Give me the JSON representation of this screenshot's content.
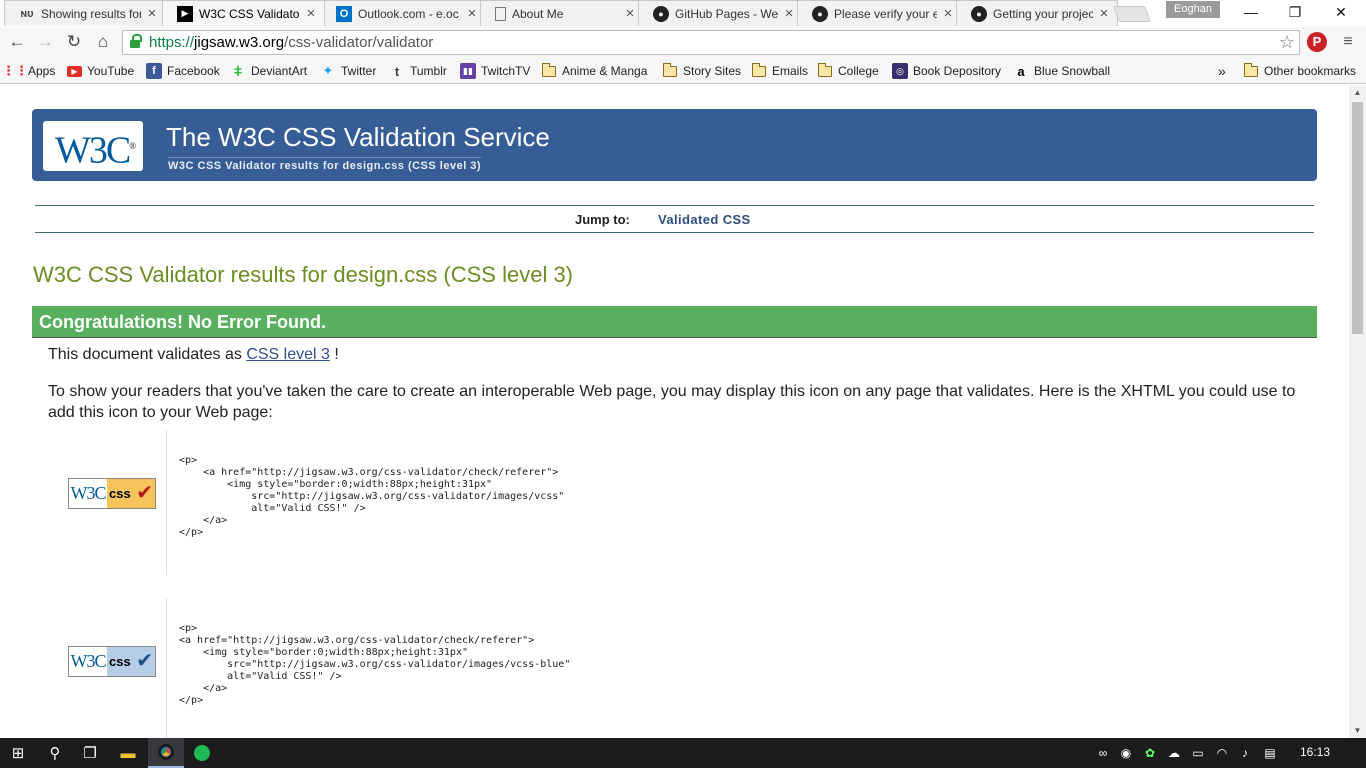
{
  "browser": {
    "tabs": [
      {
        "title": "Showing results for",
        "icon": "nu"
      },
      {
        "title": "W3C CSS Validator",
        "icon": "w3c"
      },
      {
        "title": "Outlook.com - e.oc",
        "icon": "outlook"
      },
      {
        "title": "About Me",
        "icon": "page"
      },
      {
        "title": "GitHub Pages - We",
        "icon": "github"
      },
      {
        "title": "Please verify your e",
        "icon": "github"
      },
      {
        "title": "Getting your projec",
        "icon": "github"
      }
    ],
    "profile_name": "Eoghan",
    "url": {
      "scheme": "https://",
      "host": "jigsaw.w3.org",
      "path": "/css-validator/validator"
    },
    "bookmarks": [
      {
        "label": "Apps",
        "icon": "apps"
      },
      {
        "label": "YouTube",
        "icon": "youtube"
      },
      {
        "label": "Facebook",
        "icon": "facebook"
      },
      {
        "label": "DeviantArt",
        "icon": "deviantart"
      },
      {
        "label": "Twitter",
        "icon": "twitter"
      },
      {
        "label": "Tumblr",
        "icon": "tumblr"
      },
      {
        "label": "TwitchTV",
        "icon": "twitch"
      },
      {
        "label": "Anime & Manga",
        "icon": "folder"
      },
      {
        "label": "Story Sites",
        "icon": "folder"
      },
      {
        "label": "Emails",
        "icon": "folder"
      },
      {
        "label": "College",
        "icon": "folder"
      },
      {
        "label": "Book Depository",
        "icon": "bookdepository"
      },
      {
        "label": "Blue Snowball",
        "icon": "amazon"
      }
    ],
    "overflow": "»",
    "other_bookmarks": "Other bookmarks"
  },
  "page": {
    "banner_title": "The W3C CSS Validation Service",
    "banner_subtitle": "W3C CSS Validator results for design.css (CSS level 3)",
    "logo_text": "W3C",
    "logo_mark": "®",
    "jump_label": "Jump to:",
    "jump_link": "Validated CSS",
    "results_heading": "W3C CSS Validator results for design.css (CSS level 3)",
    "congrats": "Congratulations! No Error Found.",
    "validates_prefix": "This document validates as",
    "validates_link": "CSS level 3",
    "validates_suffix": "!",
    "display_text": "To show your readers that you've taken the care to create an interoperable Web page, you may display this icon on any page that validates. Here is the XHTML you could use to add this icon to your Web page:",
    "badge_w3c": "W3C",
    "badge_css": "css",
    "badge_check": "✔",
    "code_gold": "<p>\n    <a href=\"http://jigsaw.w3.org/css-validator/check/referer\">\n        <img style=\"border:0;width:88px;height:31px\"\n            src=\"http://jigsaw.w3.org/css-validator/images/vcss\"\n            alt=\"Valid CSS!\" />\n    </a>\n</p>",
    "code_blue": "<p>\n<a href=\"http://jigsaw.w3.org/css-validator/check/referer\">\n    <img style=\"border:0;width:88px;height:31px\"\n        src=\"http://jigsaw.w3.org/css-validator/images/vcss-blue\"\n        alt=\"Valid CSS!\" />\n    </a>\n</p>"
  },
  "taskbar": {
    "clock": "16:13"
  },
  "colors": {
    "banner": "#365d95",
    "success": "#58b05f",
    "heading_green": "#6b8e23"
  }
}
